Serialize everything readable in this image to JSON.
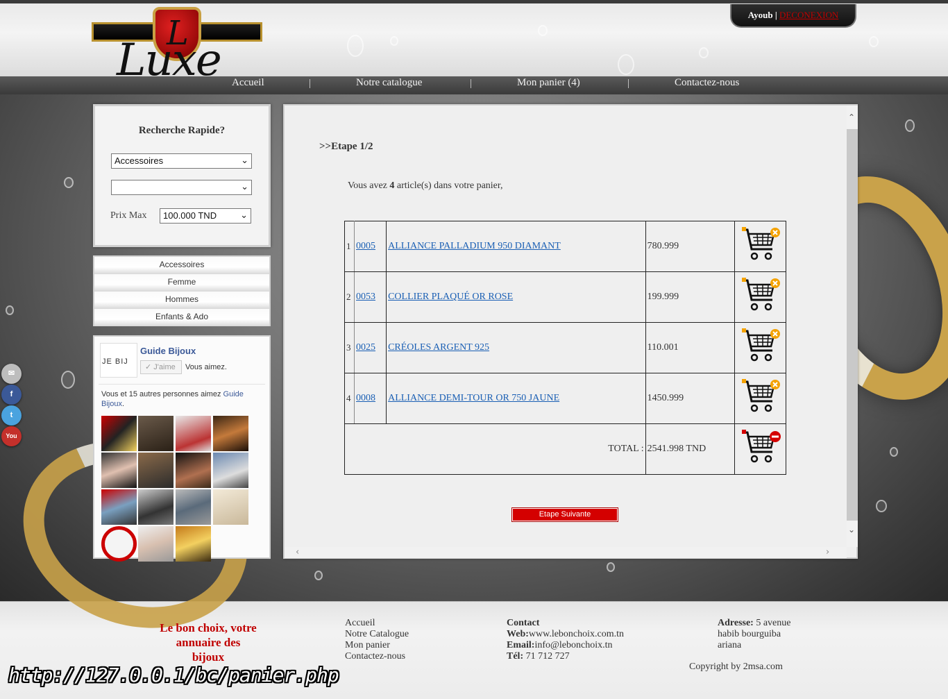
{
  "header": {
    "logo_initial": "L",
    "logo_text": "Luxe",
    "user_name": "Ayoub",
    "user_separator": " | ",
    "logout_label": "DECONEXION"
  },
  "nav": {
    "items": [
      {
        "label": "Accueil"
      },
      {
        "label": "Notre catalogue"
      },
      {
        "label": "Mon panier (4)"
      },
      {
        "label": "Contactez-nous"
      }
    ],
    "separator": "|"
  },
  "search": {
    "title": "Recherche Rapide?",
    "category_value": "Accessoires",
    "subcategory_value": "",
    "prix_label": "Prix Max",
    "prix_value": "100.000 TND"
  },
  "categories": [
    "Accessoires",
    "Femme",
    "Hommes",
    "Enfants & Ado"
  ],
  "facebook": {
    "logo_text": "JE BIJ",
    "page_name": "Guide Bijoux",
    "like_label": "J'aime",
    "like_suffix": "Vous aimez.",
    "friends_text": "Vous et 15 autres personnes aimez",
    "friends_link": "Guide Bijoux",
    "friends_end": "."
  },
  "social": [
    "mail-icon",
    "facebook-icon",
    "twitter-icon",
    "youtube-icon"
  ],
  "cart": {
    "step_label": ">>Etape 1/2",
    "count_prefix": "Vous avez ",
    "count": "4",
    "count_suffix": " article(s) dans votre panier,",
    "items": [
      {
        "index": "1",
        "ref": "0005",
        "name": "ALLIANCE PALLADIUM 950 DIAMANT",
        "price": "780.999"
      },
      {
        "index": "2",
        "ref": "0053",
        "name": "COLLIER PLAQUÉ OR ROSE",
        "price": "199.999"
      },
      {
        "index": "3",
        "ref": "0025",
        "name": "CRÉOLES ARGENT 925",
        "price": "110.001"
      },
      {
        "index": "4",
        "ref": "0008",
        "name": "ALLIANCE DEMI-TOUR OR 750 JAUNE",
        "price": "1450.999"
      }
    ],
    "total_label": "TOTAL :",
    "total_value": "2541.998 TND",
    "next_button": "Etape Suivante"
  },
  "footer": {
    "slogan_line1": "Le bon choix, votre",
    "slogan_line2": "annuaire des",
    "slogan_line3": "bijoux",
    "links": [
      "Accueil",
      "Notre Catalogue",
      "Mon panier",
      "Contactez-nous"
    ],
    "contact_title": "Contact",
    "web_label": "Web:",
    "web_value": "www.lebonchoix.com.tn",
    "email_label": "Email:",
    "email_value": "info@lebonchoix.tn",
    "tel_label": "Tél:",
    "tel_value": " 71 712 727",
    "address_label": "Adresse:",
    "address_line1": " 5 avenue",
    "address_line2": "habib bourguiba",
    "address_line3": "ariana",
    "copyright": "Copyright by 2msa.com"
  },
  "url": "http://127.0.0.1/bc/panier.php",
  "colors": {
    "accent_red": "#d40000",
    "link_blue": "#1a5fb4",
    "logout_red": "#c00000"
  }
}
